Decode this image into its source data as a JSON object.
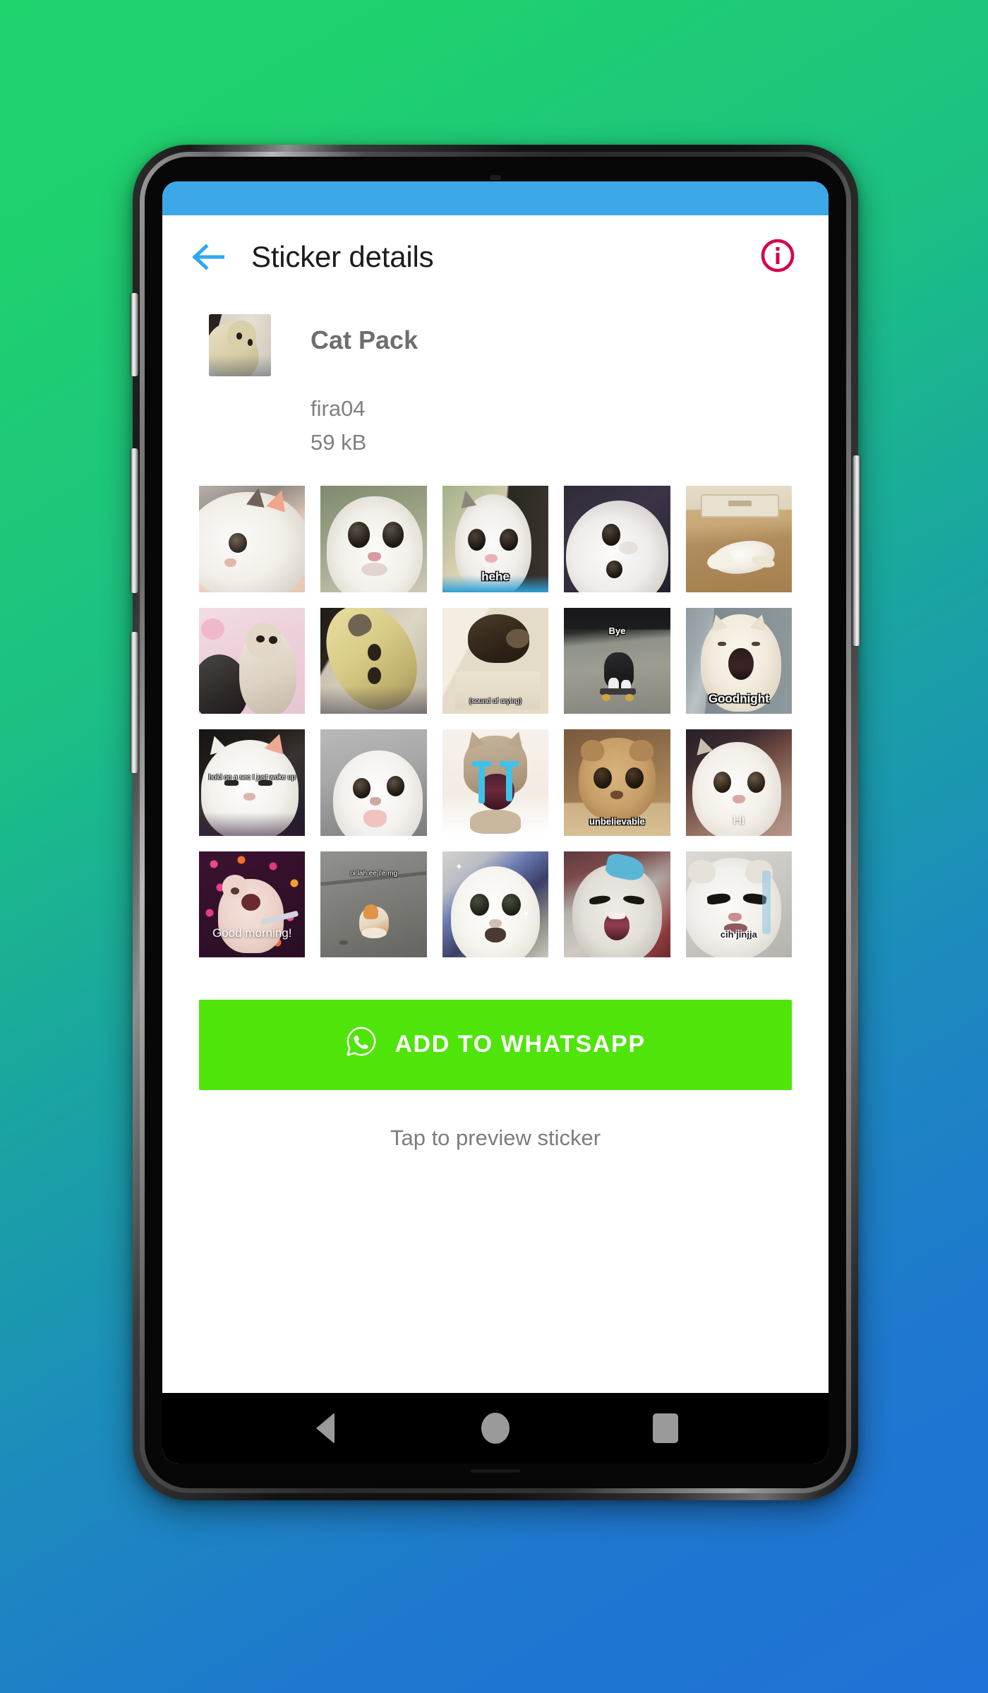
{
  "app": {
    "status_bar_color": "#3DA8E8",
    "title": "Sticker details",
    "back_icon": "arrow-left-icon",
    "info_icon": "info-circle-icon",
    "accent_blue": "#3DA8E8",
    "info_color": "#D6004F"
  },
  "pack": {
    "name": "Cat Pack",
    "author": "fira04",
    "size": "59 kB",
    "thumbnail_alt": "cat-pack-tray-thumbnail"
  },
  "stickers": [
    {
      "index": 1,
      "caption": "",
      "alt": "white-cat-big-eye-closeup"
    },
    {
      "index": 2,
      "caption": "",
      "alt": "wide-eyed-kitten-face"
    },
    {
      "index": 3,
      "caption": "hehe",
      "alt": "grey-white-kitten-hehe"
    },
    {
      "index": 4,
      "caption": "",
      "alt": "fluffy-white-kitten-dark-bg"
    },
    {
      "index": 5,
      "caption": "",
      "alt": "white-cat-lying-on-wood-floor"
    },
    {
      "index": 6,
      "caption": "",
      "alt": "two-kittens-playing-pink-bed"
    },
    {
      "index": 7,
      "caption": "",
      "alt": "cat-upside-down-yellow-light"
    },
    {
      "index": 8,
      "caption": "(sound of crying)",
      "alt": "dark-kitten-on-blanket-crying"
    },
    {
      "index": 9,
      "caption": "Bye",
      "alt": "cat-on-skateboard-bye"
    },
    {
      "index": 10,
      "caption": "Goodnight",
      "alt": "yawning-cream-cat-goodnight"
    },
    {
      "index": 11,
      "caption": "hold on a sec I just woke up",
      "alt": "sleepy-white-cat-just-woke-up"
    },
    {
      "index": 12,
      "caption": "",
      "alt": "white-cat-tongue-out-grey-bg"
    },
    {
      "index": 13,
      "caption": "",
      "alt": "tabby-cat-crying-blue-tears"
    },
    {
      "index": 14,
      "caption": "unbelievable",
      "alt": "brown-scottish-fold-unbelievable"
    },
    {
      "index": 15,
      "caption": "Hi",
      "alt": "white-cat-smiling-hi"
    },
    {
      "index": 16,
      "caption": "Good morning!",
      "alt": "cat-with-hearts-good-morning"
    },
    {
      "index": 17,
      "caption": "oi lah ee i'e mg",
      "alt": "small-orange-kitten-on-pavement"
    },
    {
      "index": 18,
      "caption": "",
      "alt": "fluffy-white-kitten-black-eyes"
    },
    {
      "index": 19,
      "caption": "",
      "alt": "angry-grey-cat-open-mouth"
    },
    {
      "index": 20,
      "caption": "cih jinjja",
      "alt": "grumpy-white-persian-cih-jinjja"
    }
  ],
  "cta": {
    "label": "ADD TO WHATSAPP",
    "icon": "whatsapp-icon",
    "color": "#4FE40A"
  },
  "hint": "Tap to preview sticker",
  "nav": {
    "back": "back-triangle-icon",
    "home": "home-circle-icon",
    "recents": "recents-square-icon"
  }
}
